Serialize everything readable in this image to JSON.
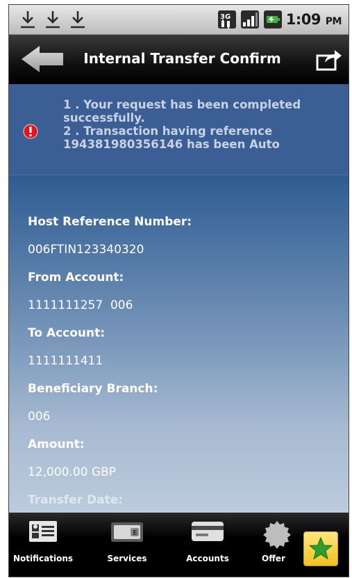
{
  "status_bar": {
    "time": "1:09",
    "ampm": "PM",
    "network": "3G",
    "icons": [
      "download-icon",
      "download-icon",
      "download-icon",
      "network-3g-icon",
      "signal-icon",
      "battery-icon"
    ]
  },
  "header": {
    "title": "Internal Transfer Confirm",
    "back_icon": "back-arrow-icon",
    "share_icon": "share-icon"
  },
  "message": {
    "icon": "error-icon",
    "lines": [
      "1 . Your request has been completed",
      "successfully.",
      "2 . Transaction having reference",
      "194381980356146 has been Auto"
    ]
  },
  "details": {
    "host_reference_label": "Host Reference Number:",
    "host_reference_value": "006FTIN123340320",
    "from_account_label": "From Account:",
    "from_account_value": "1111111257  006",
    "to_account_label": "To Account:",
    "to_account_value": "1111111411",
    "beneficiary_branch_label": "Beneficiary Branch:",
    "beneficiary_branch_value": "006",
    "amount_label": "Amount:",
    "amount_value": "12,000.00 GBP",
    "transfer_date_label": "Transfer Date:"
  },
  "bottom_nav": {
    "items": [
      {
        "label": "Notifications",
        "icon": "notifications-icon"
      },
      {
        "label": "Services",
        "icon": "services-icon"
      },
      {
        "label": "Accounts",
        "icon": "accounts-icon"
      },
      {
        "label": "Offer",
        "icon": "offers-icon"
      }
    ],
    "favorite_icon": "star-icon"
  },
  "colors": {
    "accent": "#1f4b82",
    "message_bg": "#3b5f95",
    "error": "#e0161a",
    "favorite": "#f2c020",
    "star": "#2e9e2e"
  }
}
